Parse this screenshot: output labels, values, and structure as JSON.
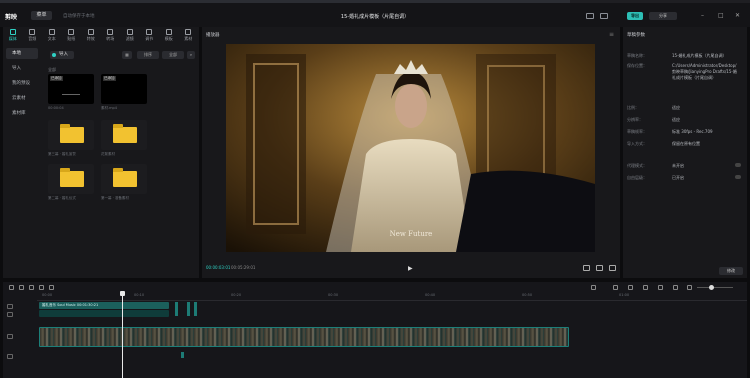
{
  "app": {
    "logo": "剪映",
    "menu_label": "菜单",
    "save_status": "自动保存于本地",
    "project_title": "15-婚礼成片模板（片尾自调）",
    "export_label": "导出",
    "share_label": "分享"
  },
  "left_panel": {
    "tools": [
      {
        "label": "媒体",
        "active": true
      },
      {
        "label": "音频"
      },
      {
        "label": "文本"
      },
      {
        "label": "贴纸"
      },
      {
        "label": "特效"
      },
      {
        "label": "转场"
      },
      {
        "label": "滤镜"
      },
      {
        "label": "调节"
      },
      {
        "label": "模板"
      },
      {
        "label": "素材"
      }
    ],
    "side_nav": [
      {
        "label": "本地",
        "active": true
      },
      {
        "label": "导入"
      },
      {
        "label": "我的预设"
      },
      {
        "label": "云素材"
      },
      {
        "label": "素材库"
      }
    ],
    "import_label": "导入",
    "sort_label": "排序",
    "filter_label": "全部",
    "section_label": "全部",
    "media_items": [
      {
        "badge": "已添加",
        "caption": "00:00:04"
      },
      {
        "badge": "已添加",
        "caption": "素材.mp4"
      },
      {
        "caption": "第三幕 · 婚礼宣誓"
      },
      {
        "caption": "花絮素材"
      },
      {
        "caption": "第二幕 · 婚礼仪式"
      },
      {
        "caption": "第一幕 · 准备素材"
      }
    ]
  },
  "player": {
    "title": "播放器",
    "time_current": "00:00:03:01",
    "time_total": "00:05:29:01"
  },
  "props": {
    "title": "草稿参数",
    "rows": [
      {
        "key": "草稿名称：",
        "value": "15-婚礼成片模板（片尾自调）"
      },
      {
        "key": "保存位置：",
        "value": "C:/Users/Administrator/Desktop/剪映草稿/JianyingPro Drafts/15-婚礼成片模板（片尾自调）"
      },
      {
        "key": "比例：",
        "value": "适应"
      },
      {
        "key": "分辨率：",
        "value": "适应"
      },
      {
        "key": "草稿帧率：",
        "value": "标准 30fps - Rec.709"
      },
      {
        "key": "导入方式：",
        "value": "保留在原有位置"
      },
      {
        "key": "代理模式：",
        "value": "未开启"
      },
      {
        "key": "自由层级：",
        "value": "已开启"
      }
    ],
    "modify_label": "修改"
  },
  "timeline": {
    "ruler_ticks": [
      "00:00",
      "00:10",
      "00:20",
      "00:30",
      "00:40",
      "00:50",
      "01:00"
    ],
    "audio_clip_label": "婚礼音乐  Soul Music  00:01:30:21",
    "zoom_level": 0.35
  },
  "colors": {
    "accent": "#2fd1c4",
    "panel": "#18181b",
    "background": "#0c0c0e",
    "folder": "#f2c230"
  }
}
